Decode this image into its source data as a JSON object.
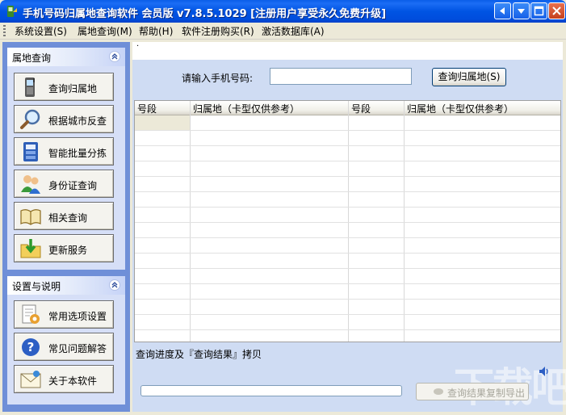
{
  "window": {
    "title": "手机号码归属地查询软件 会员版 v7.8.5.1029 [注册用户享受永久免费升级]"
  },
  "menu": {
    "items": [
      "系统设置(S)",
      "属地查询(M)",
      "帮助(H)",
      "软件注册购买(R)",
      "激活数据库(A)"
    ]
  },
  "sidebar": {
    "section1": {
      "title": "属地查询",
      "items": [
        {
          "label": "查询归属地",
          "icon": "mobile-phone-icon"
        },
        {
          "label": "根据城市反查",
          "icon": "magnifier-icon"
        },
        {
          "label": "智能批量分拣",
          "icon": "database-icon"
        },
        {
          "label": "身份证查询",
          "icon": "users-icon"
        },
        {
          "label": "相关查询",
          "icon": "book-icon"
        },
        {
          "label": "更新服务",
          "icon": "folder-download-icon"
        }
      ]
    },
    "section2": {
      "title": "设置与说明",
      "items": [
        {
          "label": "常用选项设置",
          "icon": "settings-document-icon"
        },
        {
          "label": "常见问题解答",
          "icon": "help-icon"
        },
        {
          "label": "关于本软件",
          "icon": "envelope-icon"
        }
      ]
    }
  },
  "main": {
    "dot": "·",
    "phone_label": "请输入手机号码:",
    "phone_value": "",
    "query_button": "查询归属地(S)",
    "columns": [
      "号段",
      "归属地（卡型仅供参考）",
      "号段",
      "归属地（卡型仅供参考）"
    ],
    "progress_label": "查询进度及『查询结果』拷贝",
    "progress_value": 0,
    "export_button": "查询结果复制导出",
    "watermark": "下载吧"
  },
  "colors": {
    "titlebar": "#0054e3",
    "sidebar_bg": "#6f8fd8",
    "main_bg": "#cfdcf3"
  }
}
